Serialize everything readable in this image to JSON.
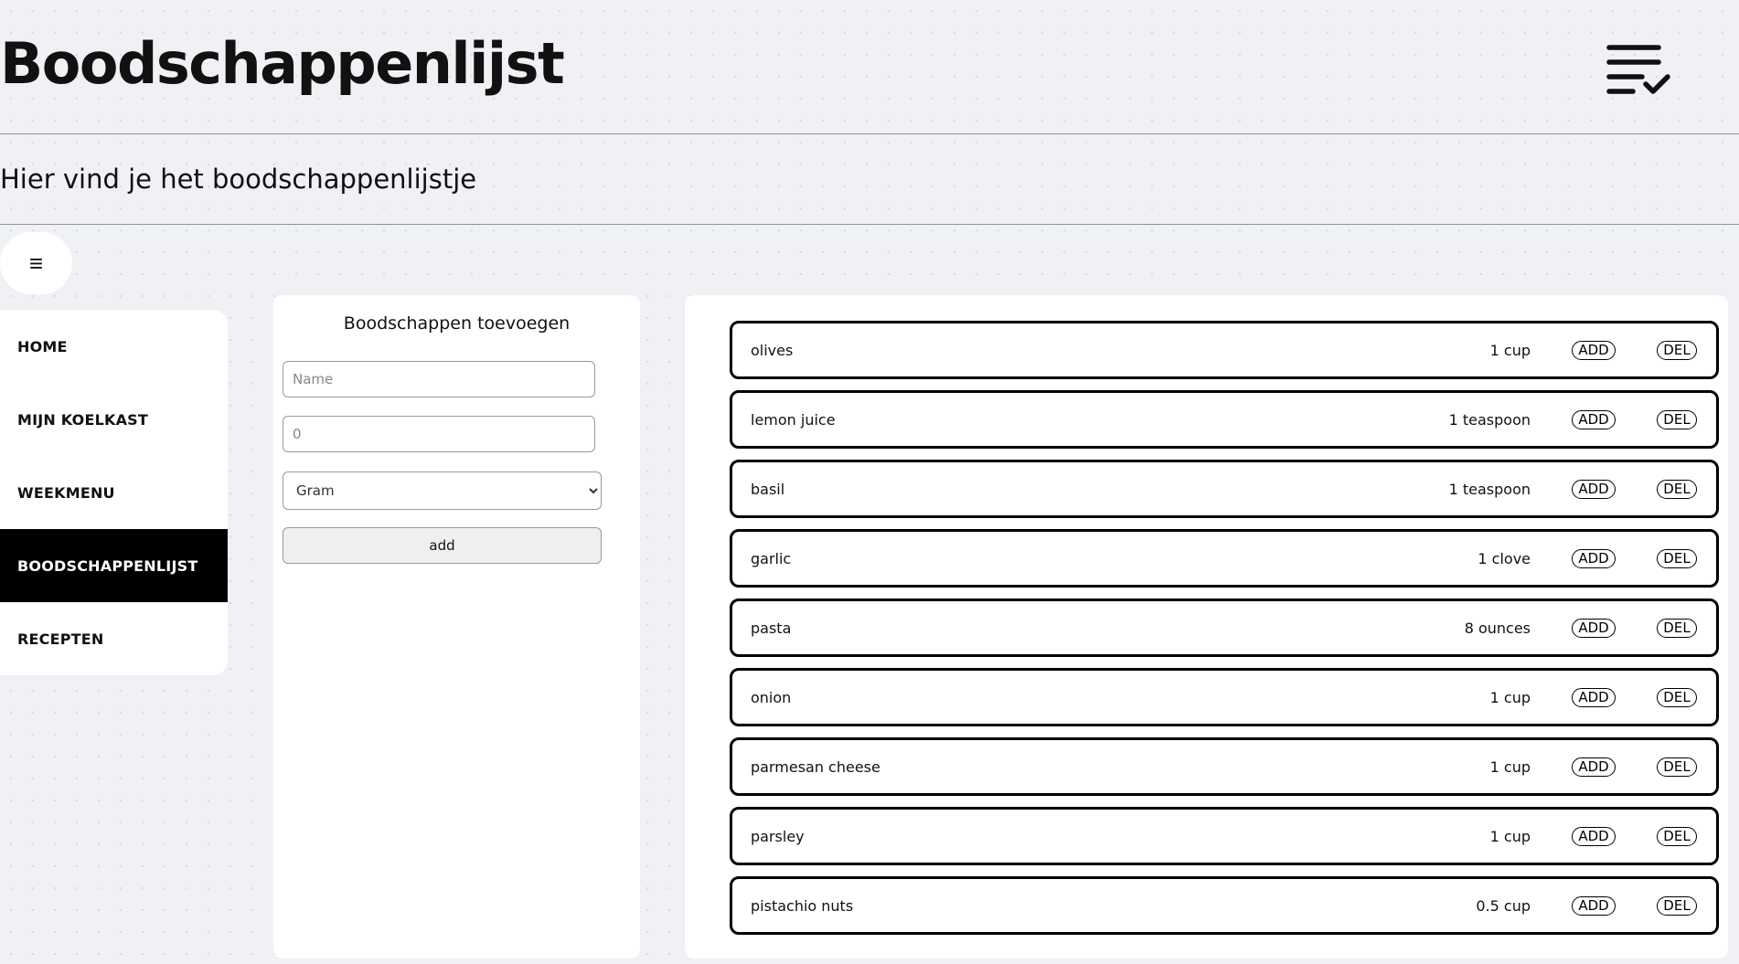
{
  "header": {
    "title": "Boodschappenlijst",
    "icon": "list-check-icon"
  },
  "subheader": {
    "text": "Hier vind je het boodschappenlijstje"
  },
  "menu_toggle": {
    "glyph": "≡",
    "icon": "hamburger-menu-icon"
  },
  "sidebar": {
    "items": [
      {
        "label": "HOME",
        "active": false
      },
      {
        "label": "MIJN KOELKAST",
        "active": false
      },
      {
        "label": "WEEKMENU",
        "active": false
      },
      {
        "label": "BOODSCHAPPENLIJST",
        "active": true
      },
      {
        "label": "RECEPTEN",
        "active": false
      }
    ]
  },
  "form": {
    "title": "Boodschappen toevoegen",
    "name_placeholder": "Name",
    "quantity_placeholder": "0",
    "unit_selected": "Gram",
    "add_label": "add"
  },
  "list": {
    "add_label": "ADD",
    "del_label": "DEL",
    "items": [
      {
        "name": "olives",
        "quantity": "1 cup"
      },
      {
        "name": "lemon juice",
        "quantity": "1 teaspoon"
      },
      {
        "name": "basil",
        "quantity": "1 teaspoon"
      },
      {
        "name": "garlic",
        "quantity": "1 clove"
      },
      {
        "name": "pasta",
        "quantity": "8 ounces"
      },
      {
        "name": "onion",
        "quantity": "1 cup"
      },
      {
        "name": "parmesan cheese",
        "quantity": "1 cup"
      },
      {
        "name": "parsley",
        "quantity": "1 cup"
      },
      {
        "name": "pistachio nuts",
        "quantity": "0.5 cup"
      }
    ]
  },
  "colors": {
    "background": "#eff1f4",
    "panel": "#ffffff",
    "active_nav": "#000000",
    "border": "#000000"
  }
}
